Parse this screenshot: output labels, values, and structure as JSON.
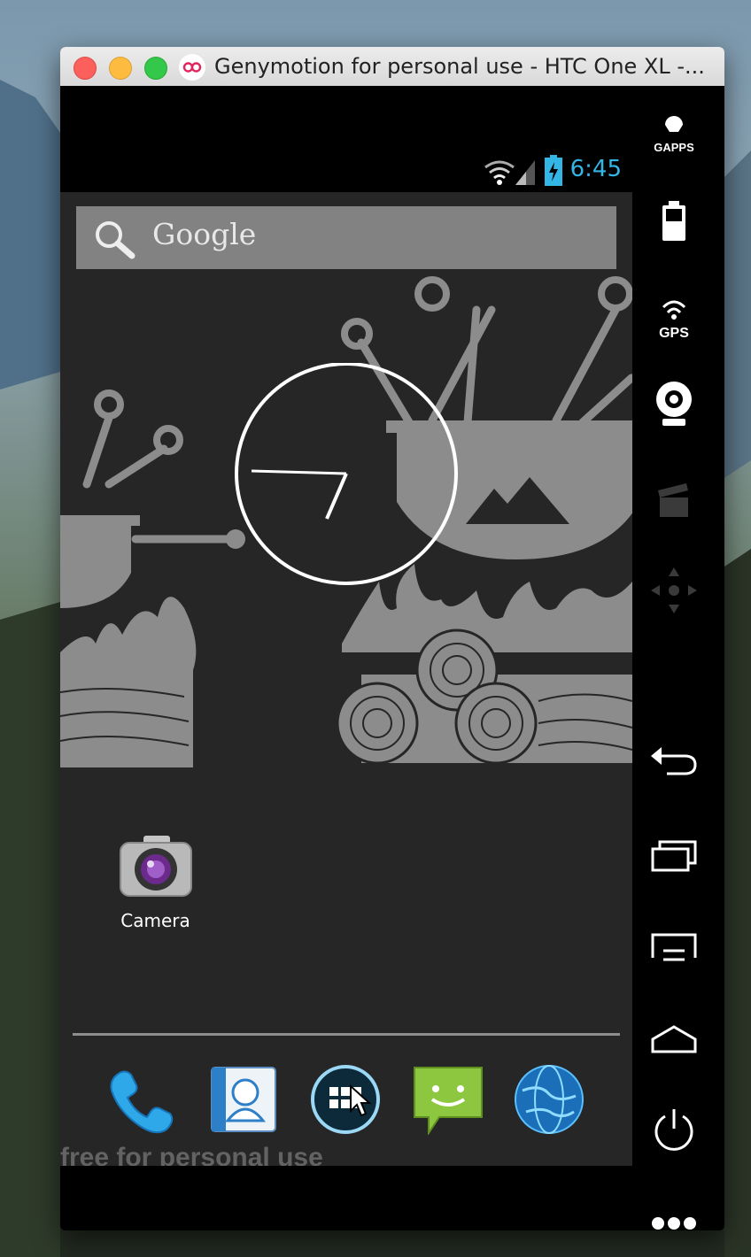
{
  "window": {
    "title": "Genymotion for personal use - HTC One XL -..."
  },
  "status_bar": {
    "time": "6:45"
  },
  "search": {
    "label": "Google"
  },
  "desktop": {
    "camera_label": "Camera"
  },
  "watermark": "free for personal use",
  "sidebar": {
    "gapps_label": "GAPPS",
    "gps_label": "GPS"
  },
  "colors": {
    "status_time": "#33b5e5",
    "home_background": "#262626",
    "sidebar": "#000000"
  },
  "icons": {
    "dock": [
      "phone-icon",
      "contacts-icon",
      "app-drawer-icon",
      "messaging-icon",
      "browser-icon"
    ],
    "sidebar": [
      "gapps-icon",
      "battery-icon",
      "gps-icon",
      "webcam-icon",
      "screencast-icon",
      "dpad-icon",
      "back-icon",
      "recent-apps-icon",
      "menu-icon",
      "home-icon",
      "power-icon",
      "more-icon"
    ]
  }
}
